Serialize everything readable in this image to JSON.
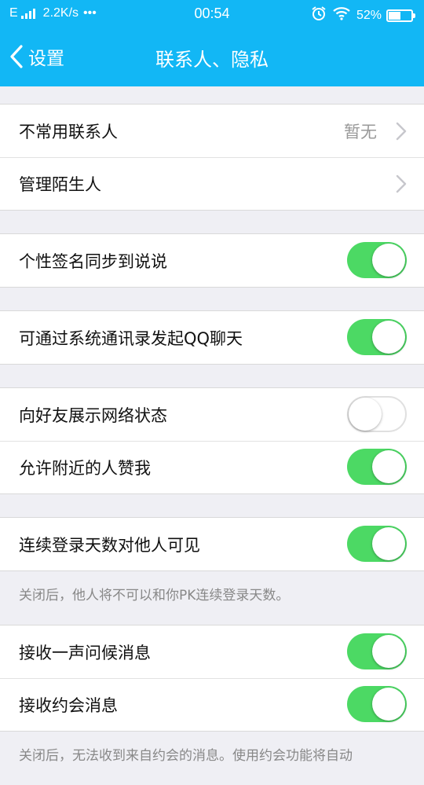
{
  "status_bar": {
    "network": "E",
    "speed": "2.2K/s",
    "dots": "•••",
    "time": "00:54",
    "battery": "52%",
    "battery_level": 0.52
  },
  "nav": {
    "back_label": "设置",
    "title": "联系人、隐私"
  },
  "sections": {
    "contacts": {
      "uncommon_label": "不常用联系人",
      "uncommon_value": "暂无",
      "strangers_label": "管理陌生人"
    },
    "signature_sync": {
      "label": "个性签名同步到说说",
      "enabled": true
    },
    "system_contacts": {
      "label": "可通过系统通讯录发起QQ聊天",
      "enabled": true
    },
    "presence": {
      "network_status_label": "向好友展示网络状态",
      "network_status_enabled": false,
      "nearby_like_label": "允许附近的人赞我",
      "nearby_like_enabled": true
    },
    "login_days": {
      "label": "连续登录天数对他人可见",
      "enabled": true,
      "note": "关闭后，他人将不可以和你PK连续登录天数。"
    },
    "messages": {
      "greeting_label": "接收一声问候消息",
      "greeting_enabled": true,
      "date_label": "接收约会消息",
      "date_enabled": true,
      "note": "关闭后，无法收到来自约会的消息。使用约会功能将自动"
    }
  },
  "colors": {
    "accent": "#12b7f5",
    "toggle_on": "#4cd964",
    "background": "#efeff4"
  }
}
